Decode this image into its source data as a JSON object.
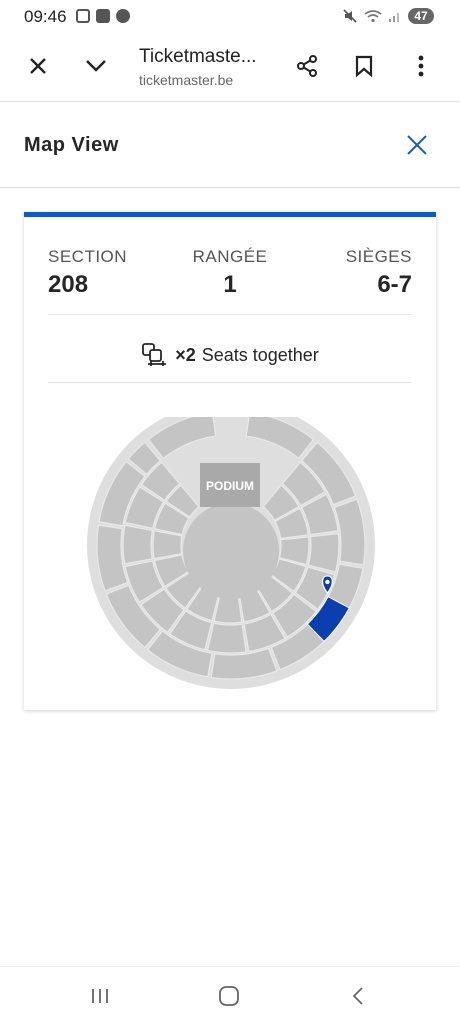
{
  "status": {
    "time": "09:46",
    "battery": "47"
  },
  "browser": {
    "title": "Ticketmaste...",
    "url": "ticketmaster.be"
  },
  "map_view": {
    "title": "Map View"
  },
  "ticket": {
    "section_label": "SECTION",
    "section_value": "208",
    "row_label": "RANGÉE",
    "row_value": "1",
    "seats_label": "SIÈGES",
    "seats_value": "6-7",
    "together_count": "×2",
    "together_text": "Seats together"
  },
  "venue_map": {
    "stage_label": "PODIUM",
    "highlight_color": "#0b3fb0"
  }
}
